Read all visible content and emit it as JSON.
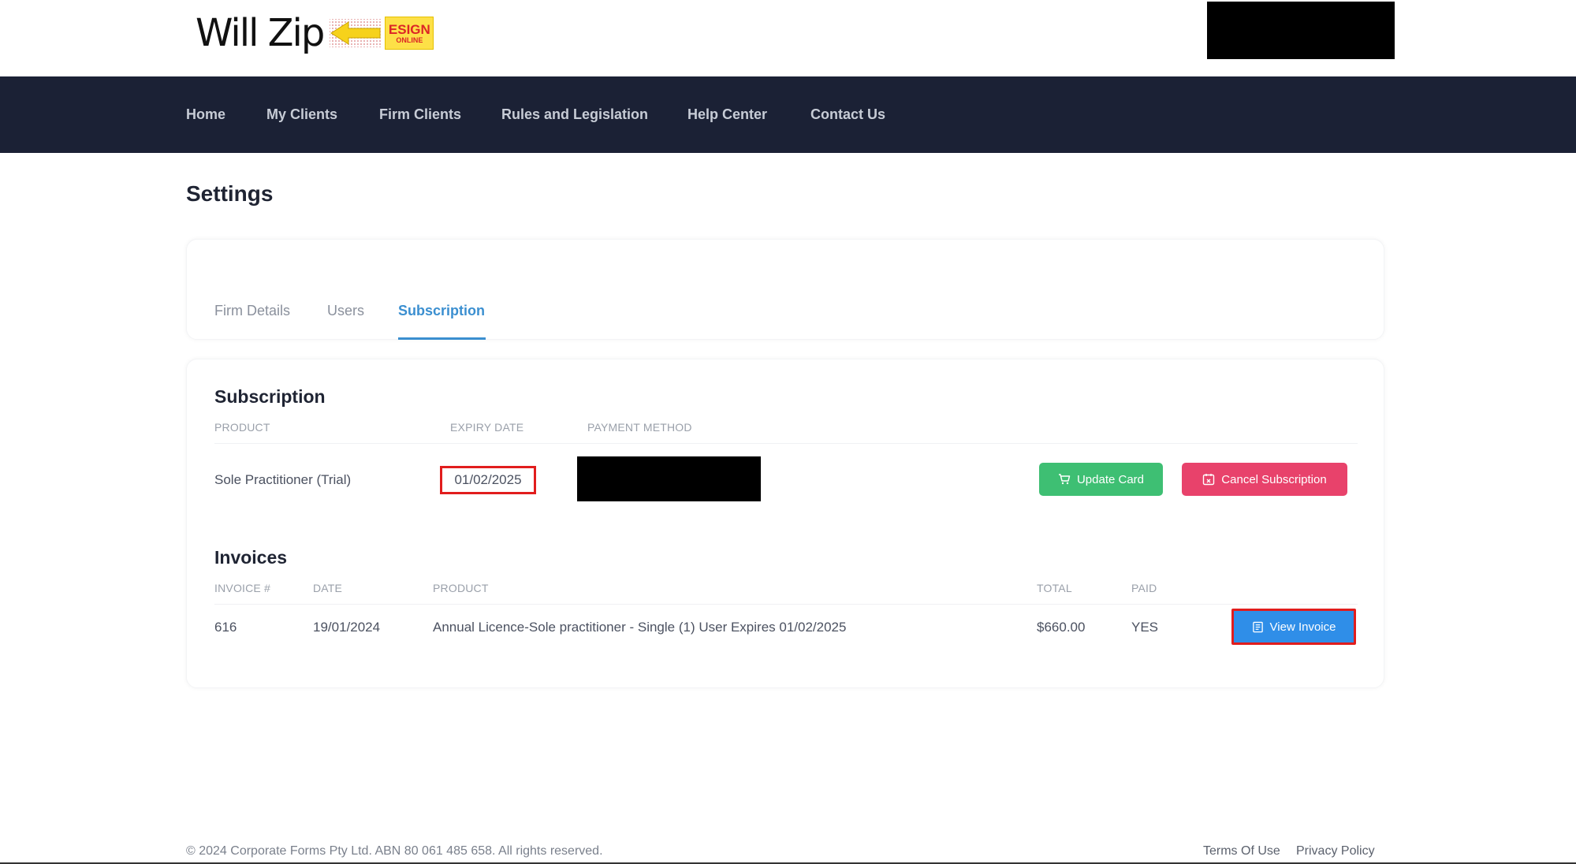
{
  "header": {
    "logo_text": "Will Zip",
    "logo_badge_top": "ESIGN",
    "logo_badge_bottom": "ONLINE"
  },
  "nav": {
    "items": [
      "Home",
      "My Clients",
      "Firm Clients",
      "Rules and Legislation",
      "Help Center",
      "Contact Us"
    ]
  },
  "page": {
    "title": "Settings"
  },
  "tabs": {
    "items": [
      "Firm Details",
      "Users",
      "Subscription"
    ],
    "active": "Subscription"
  },
  "subscription": {
    "title": "Subscription",
    "columns": [
      "PRODUCT",
      "EXPIRY DATE",
      "PAYMENT METHOD"
    ],
    "row": {
      "product": "Sole Practitioner (Trial)",
      "expiry_date": "01/02/2025"
    },
    "update_card_label": "Update Card",
    "cancel_label": "Cancel Subscription"
  },
  "invoices": {
    "title": "Invoices",
    "columns": [
      "INVOICE #",
      "DATE",
      "PRODUCT",
      "TOTAL",
      "PAID"
    ],
    "rows": [
      {
        "invoice": "616",
        "date": "19/01/2024",
        "product": "Annual Licence-Sole practitioner - Single (1) User Expires 01/02/2025",
        "total": "$660.00",
        "paid": "YES"
      }
    ],
    "view_label": "View Invoice"
  },
  "footer": {
    "copyright": "© 2024 Corporate Forms Pty Ltd. ABN 80 061 485 658. All rights reserved.",
    "links": [
      "Terms Of Use",
      "Privacy Policy"
    ]
  },
  "colors": {
    "nav_bg": "#1b2135",
    "accent": "#3b8fd0",
    "green": "#3ebf73",
    "red": "#e8426b",
    "blue": "#2f8ee8",
    "highlight": "#e11d1d"
  }
}
